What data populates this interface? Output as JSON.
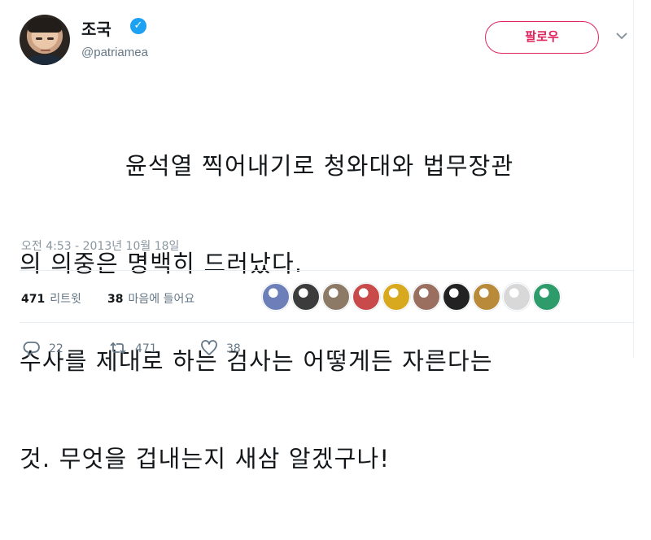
{
  "author": {
    "display_name": "조국",
    "handle": "@patriamea",
    "verified_mark": "✓"
  },
  "follow_button": {
    "label": "팔로우"
  },
  "tweet": {
    "lines": [
      "윤석열 찍어내기로 청와대와 법무장관",
      "의 의중은 명백히 드러났다.",
      "수사를 제대로 하는 검사는 어떻게든 자른다는",
      "것. 무엇을 겁내는지 새삼 알겠구나!"
    ],
    "timestamp": "오전 4:53 - 2013년 10월 18일"
  },
  "stats": {
    "retweets_count": "471",
    "retweets_label": "리트윗",
    "likes_count": "38",
    "likes_label": "마음에 들어요"
  },
  "likers": [
    {
      "name": "liker-avatar-1",
      "color": "#6c7fb8"
    },
    {
      "name": "liker-avatar-2",
      "color": "#3c3c3c"
    },
    {
      "name": "liker-avatar-3",
      "color": "#8d7a66"
    },
    {
      "name": "liker-avatar-4",
      "color": "#c94a4a"
    },
    {
      "name": "liker-avatar-5",
      "color": "#d8a91e"
    },
    {
      "name": "liker-avatar-6",
      "color": "#9a6f5f"
    },
    {
      "name": "liker-avatar-7",
      "color": "#222222"
    },
    {
      "name": "liker-avatar-8",
      "color": "#b88a3a"
    },
    {
      "name": "liker-avatar-9",
      "color": "#d8d8d8"
    },
    {
      "name": "liker-avatar-10",
      "color": "#2e9c6a"
    }
  ],
  "actions": {
    "reply_count": "22",
    "retweet_count": "471",
    "like_count": "38"
  },
  "colors": {
    "accent_follow": "#e0245e",
    "verified": "#1da1f2",
    "muted_text": "#657786"
  },
  "icons": [
    "verified-badge-icon",
    "chevron-down-icon",
    "reply-icon",
    "retweet-icon",
    "heart-icon"
  ]
}
